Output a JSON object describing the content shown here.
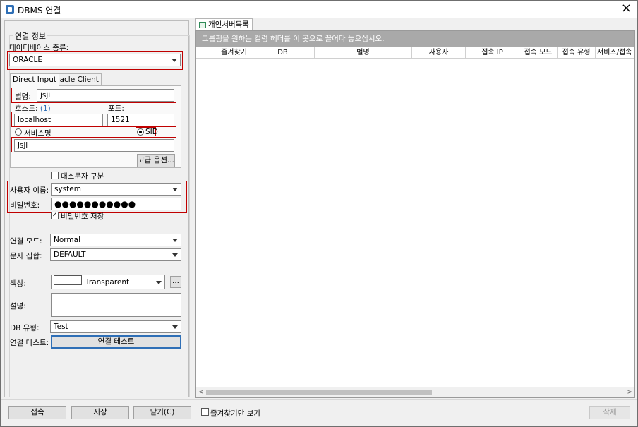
{
  "window": {
    "title": "DBMS 연결"
  },
  "conn_info": {
    "group_title": "연결 정보",
    "db_type_label": "데이터베이스 종류:",
    "db_type_value": "ORACLE",
    "tab_direct": "Direct Input",
    "tab_client": "Oracle Client",
    "alias_label": "별명:",
    "alias_value": "jsji",
    "host_label": "호스트:",
    "host_count": "(1)",
    "port_label": "포트:",
    "host_value": "localhost",
    "port_value": "1521",
    "service_label": "서비스명",
    "sid_label": "SID",
    "sid_value": "jsji",
    "advanced_label": "고급 옵션...",
    "case_label": "대소문자 구분",
    "user_label": "사용자 이름:",
    "user_value": "system",
    "pw_label": "비밀번호:",
    "pw_value": "●●●●●●●●●●●",
    "save_pw_label": "비밀번호 저장",
    "mode_label": "연결 모드:",
    "mode_value": "Normal",
    "charset_label": "문자 집합:",
    "charset_value": "DEFAULT",
    "color_label": "색상:",
    "color_value": "Transparent",
    "color_more": "...",
    "desc_label": "설명:",
    "dbtype_label": "DB 유형:",
    "dbtype_value": "Test",
    "test_label": "연결 테스트:",
    "test_button": "연결 테스트"
  },
  "right": {
    "tab_label": "개인서버목록",
    "group_hint": "그룹핑을 원하는 컬럼 헤더를 이 곳으로 끌어다 놓으십시오.",
    "columns": [
      "즐겨찾기",
      "DB",
      "별명",
      "사용자",
      "접속 IP",
      "접속 모드",
      "접속 유형",
      "서비스/접속 I"
    ]
  },
  "footer": {
    "connect": "접속",
    "save": "저장",
    "close": "닫기(C)",
    "fav_only": "즐겨찾기만 보기",
    "delete": "삭제"
  },
  "icons": [
    "app-icon",
    "close-icon",
    "list-icon",
    "dropdown-arrow-icon",
    "scroll-left-icon",
    "scroll-right-icon"
  ]
}
